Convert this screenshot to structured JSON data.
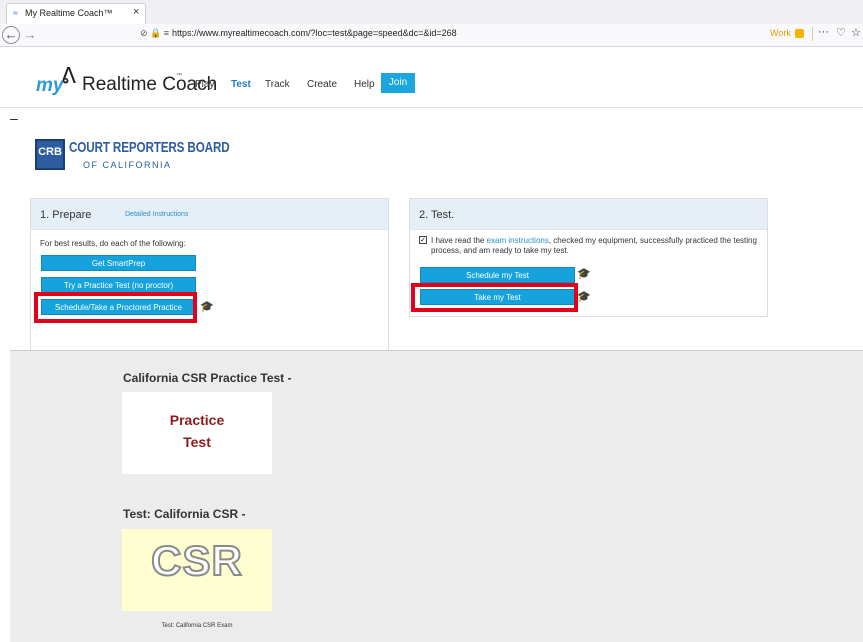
{
  "browser": {
    "tab_title": "My Realtime Coach™",
    "tab_close": "×",
    "back_icon": "←",
    "forward_icon": "→",
    "url": "https://www.myrealtimecoach.com/?loc=test&page=speed&dc=&id=268",
    "url_icons": "⊘ 🔒 ≡",
    "work_label": "Work",
    "more_icon": "···",
    "pocket_icon": "♡",
    "star_icon": "☆"
  },
  "site": {
    "logo_my": "my",
    "logo_runner": "ᕕ",
    "logo_text": "Realtime Coach",
    "logo_tm": "™",
    "nav": [
      "Play",
      "Test",
      "Track",
      "Create",
      "Help"
    ],
    "join_label": "Join",
    "dash": "–"
  },
  "crb": {
    "abbr": "CRB",
    "title": "COURT REPORTERS BOARD",
    "subtitle": "OF CALIFORNIA"
  },
  "prepare": {
    "title": "1. Prepare",
    "detail_link": "Detailed Instructions",
    "intro": "For best results, do each of the following:",
    "buttons": [
      "Get SmartPrep",
      "Try a Practice Test (no proctor)",
      "Schedule/Take a Proctored Practice"
    ]
  },
  "test": {
    "title": "2. Test.",
    "checkbox_checked": true,
    "check_mark": "✓",
    "text_before": "I have read the ",
    "link": "exam instructions",
    "text_after": ", checked my equipment, successfully practiced the testing process, and am ready to take my test.",
    "schedule_label": "Schedule my Test",
    "take_label": "Take my Test"
  },
  "graduate_icon": "🎓",
  "lower": {
    "practice_heading": "California CSR Practice Test -",
    "practice_card_line1": "Practice",
    "practice_card_line2": "Test",
    "test_heading": "Test: California CSR -",
    "csr_logo": "CSR",
    "test_caption": "Test: California CSR Exam"
  },
  "colors": {
    "accent": "#16a3dd",
    "highlight": "#e2001a",
    "crb_blue": "#2d5da0",
    "practice_red": "#8b1a1a"
  }
}
